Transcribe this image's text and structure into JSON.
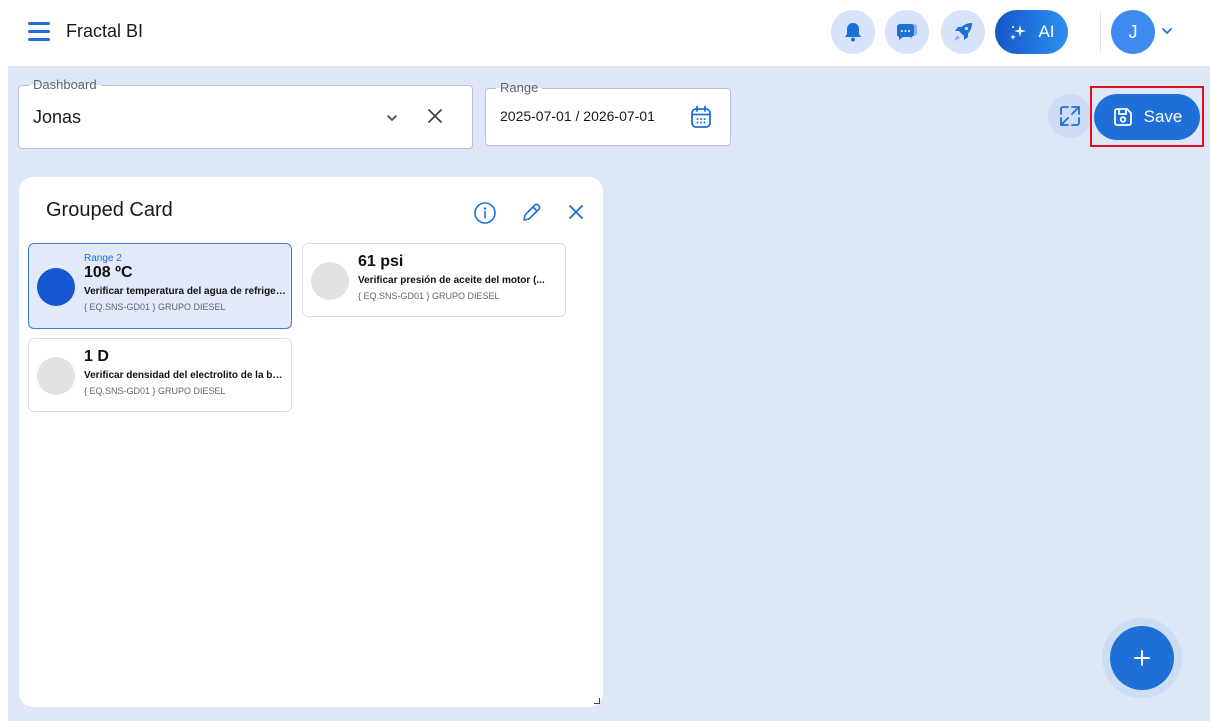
{
  "header": {
    "app_title": "Fractal BI",
    "ai_label": "AI",
    "avatar_initial": "J"
  },
  "filters": {
    "dashboard_label": "Dashboard",
    "dashboard_value": "Jonas",
    "range_label": "Range",
    "range_value": "2025-07-01 / 2026-07-01"
  },
  "toolbar": {
    "save_label": "Save"
  },
  "panel": {
    "title": "Grouped Card",
    "cards": [
      {
        "range_label": "Range 2",
        "value": "108 ºC",
        "description": "Verificar temperatura del agua de refrigeración",
        "subtitle": "{ EQ.SNS-GD01 } GRUPO DIESEL"
      },
      {
        "value": "61 psi",
        "description": "Verificar presión de aceite del motor (...",
        "subtitle": "{ EQ.SNS-GD01 } GRUPO DIESEL"
      },
      {
        "value": "1 D",
        "description": "Verificar densidad del electrolito de la batería",
        "subtitle": "{ EQ.SNS-GD01 } GRUPO DIESEL"
      }
    ]
  },
  "colors": {
    "primary": "#1f6fd8",
    "background": "#dde7f7",
    "highlight": "#e0101a",
    "active_dot": "#1557d0"
  }
}
